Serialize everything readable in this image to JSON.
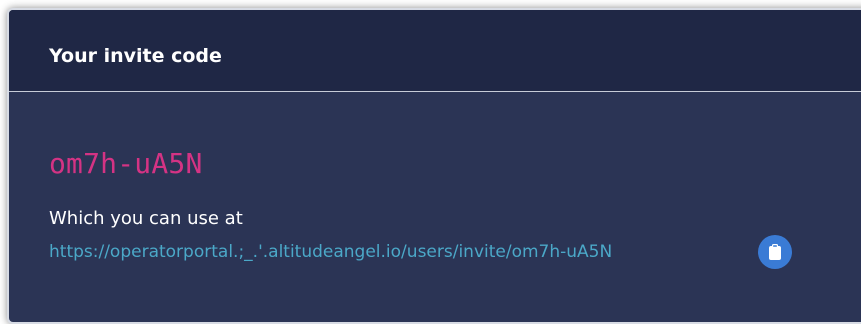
{
  "invite_panel": {
    "title": "Your invite code",
    "code": "om7h-uA5N",
    "use_at_text": "Which you can use at",
    "link_text": "https://operatorportal.;_.'.altitudeangel.io/users/invite/om7h-uA5N",
    "copy_icon": "clipboard-icon"
  },
  "colors": {
    "panel_background": "#2b3455",
    "header_background": "#1f2745",
    "code_text": "#d43384",
    "link_text": "#4ba8c8",
    "copy_button": "#3a7bd5",
    "border": "#d7dbe4"
  }
}
